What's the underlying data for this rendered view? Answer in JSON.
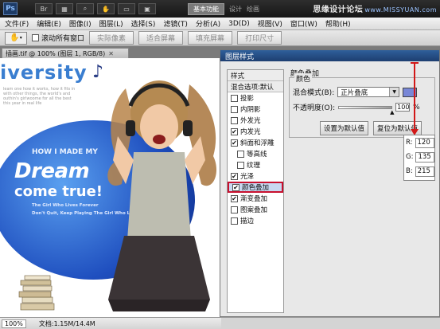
{
  "appbar": {
    "logo": "Ps",
    "workspace_active": "基本功能",
    "workspace_tabs": [
      "设计",
      "绘画"
    ],
    "watermark_name": "思缘设计论坛",
    "watermark_url": "www.MISSYUAN.com"
  },
  "menu": [
    "文件(F)",
    "编辑(E)",
    "图像(I)",
    "图层(L)",
    "选择(S)",
    "滤镜(T)",
    "分析(A)",
    "3D(D)",
    "视图(V)",
    "窗口(W)",
    "帮助(H)"
  ],
  "options": {
    "scroll_all": "滚动所有窗口",
    "actual_pixels": "实际像素",
    "fit_screen": "适合屏幕",
    "fill_screen": "填充屏幕",
    "print_size": "打印尺寸"
  },
  "document": {
    "tab_title": "插画.tif @ 100% (图层 1, RGB/8)",
    "zoom": "100%",
    "doc_info": "文档:1.15M/14.4M"
  },
  "artwork": {
    "title": "iversity",
    "subtitle": "leam one how it works, how it fits in with other things, the world's and outhin's girlwoome for all the best this year in real life",
    "how": "HOW I MADE MY",
    "dream": "Dream",
    "come_true": "come true!",
    "tag1": "The Girl Who Lives Forever",
    "tag2": "Don't Quit, Keep Playing The Girl Who Lives"
  },
  "dialog": {
    "title": "图层样式",
    "list_header": "样式",
    "list_blend": "混合选项:默认",
    "effects": [
      {
        "label": "投影",
        "checked": false
      },
      {
        "label": "内阴影",
        "checked": false
      },
      {
        "label": "外发光",
        "checked": false
      },
      {
        "label": "内发光",
        "checked": true
      },
      {
        "label": "斜面和浮雕",
        "checked": true
      },
      {
        "label": "等高线",
        "checked": false
      },
      {
        "label": "纹理",
        "checked": false
      },
      {
        "label": "光泽",
        "checked": true
      },
      {
        "label": "颜色叠加",
        "checked": true
      },
      {
        "label": "渐变叠加",
        "checked": true
      },
      {
        "label": "图案叠加",
        "checked": false
      },
      {
        "label": "描边",
        "checked": false
      }
    ],
    "section_title": "颜色叠加",
    "group_label": "颜色",
    "blend_mode_label": "混合模式(B):",
    "blend_mode_value": "正片叠底",
    "opacity_label": "不透明度(O):",
    "opacity_value": "100",
    "opacity_unit": "%",
    "make_default": "设置为默认值",
    "reset_default": "复位为默认值",
    "overlay_color": "#7887d7"
  },
  "rgb": {
    "r_label": "R:",
    "r": "120",
    "g_label": "G:",
    "g": "135",
    "b_label": "B:",
    "b": "215"
  }
}
